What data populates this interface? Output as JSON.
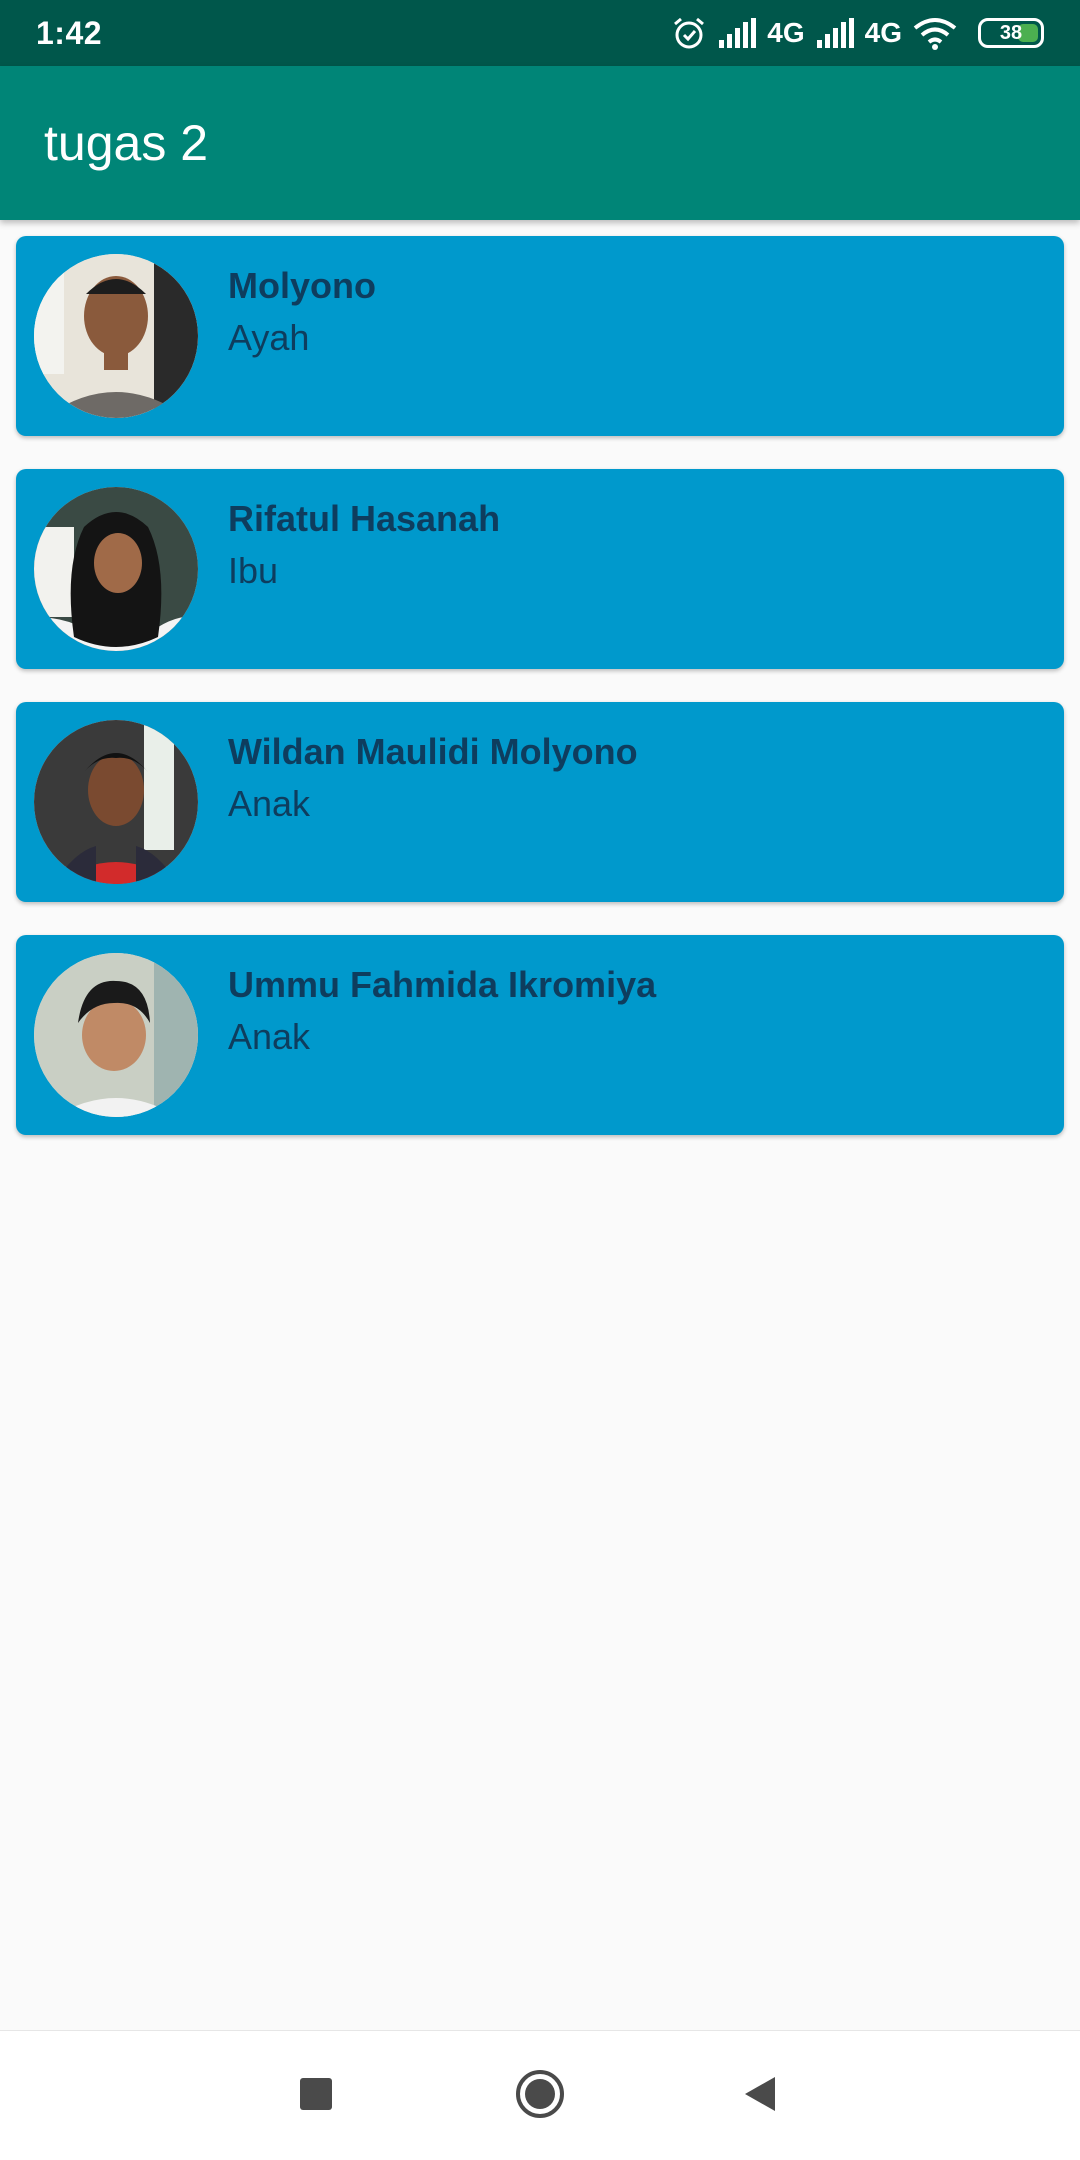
{
  "status_bar": {
    "time": "1:42",
    "network_1": "4G",
    "network_2": "4G",
    "battery": "38"
  },
  "app_bar": {
    "title": "tugas 2"
  },
  "contacts": [
    {
      "name": "Molyono",
      "role": "Ayah"
    },
    {
      "name": "Rifatul Hasanah",
      "role": "Ibu"
    },
    {
      "name": "Wildan Maulidi Molyono",
      "role": "Anak"
    },
    {
      "name": "Ummu Fahmida Ikromiya",
      "role": "Anak"
    }
  ],
  "colors": {
    "status_bar": "#00574b",
    "app_bar": "#008577",
    "card": "#0099cc",
    "card_text": "#0e3d5e",
    "background": "#fafafa"
  },
  "nav_bar": {
    "icons": [
      "recents-icon",
      "home-icon",
      "back-icon"
    ]
  }
}
